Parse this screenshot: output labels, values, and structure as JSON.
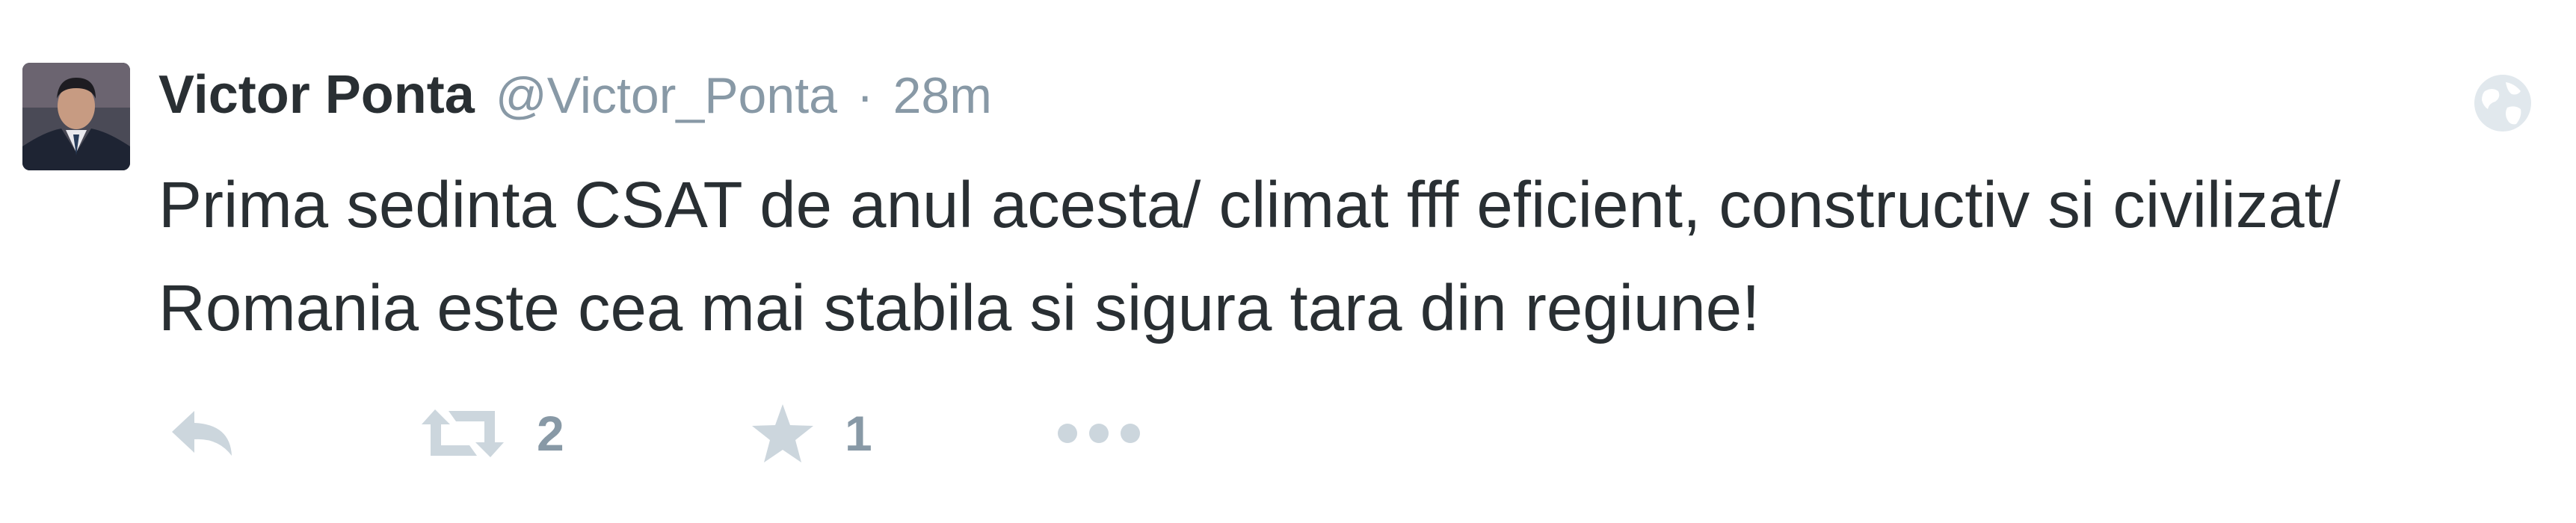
{
  "tweet": {
    "fullname": "Victor Ponta",
    "username": "@Victor_Ponta",
    "separator": "·",
    "timestamp": "28m",
    "text_line1": "Prima sedinta CSAT de anul acesta/ climat fff eficient, constructiv si civilizat/",
    "text_line2": "Romania este cea mai stabila si sigura tara din regiune!",
    "retweet_count": "2",
    "favorite_count": "1",
    "icons": {
      "avatar": "profile-photo",
      "globe": "globe-icon",
      "reply": "reply-icon",
      "retweet": "retweet-icon",
      "favorite": "star-icon",
      "more": "more-icon"
    },
    "colors": {
      "text": "#292f33",
      "muted": "#8899a6",
      "icon": "#ccd6dd"
    }
  }
}
